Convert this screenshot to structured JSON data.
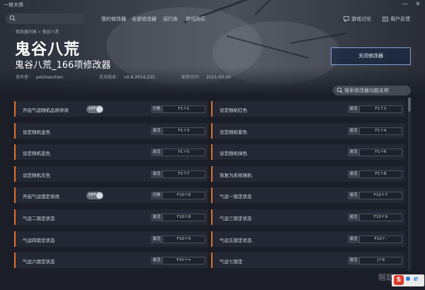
{
  "app": {
    "title": "一修大师"
  },
  "window": {
    "minimize": "—",
    "close": "✕"
  },
  "nav": {
    "items": [
      "我的修改器",
      "全部修改器",
      "运行库",
      "游戏购买"
    ]
  },
  "topright": {
    "discuss": "游戏讨论",
    "feedback": "用户反馈"
  },
  "breadcrumb": "修改器列表 » 鬼谷八荒",
  "game": {
    "title": "鬼谷八荒",
    "trainer_title": "鬼谷八荒_166项修改器"
  },
  "meta": {
    "publisher_label": "发布者：",
    "publisher": "peizhaochen",
    "version_label": "支持版本：",
    "version": "v0.8.2014.235",
    "updated_label": "更新时间：",
    "updated": "2021-03-30"
  },
  "close_trainer_button": "关闭修改器",
  "feature_search": {
    "placeholder": "搜索修改器功能名称"
  },
  "features": [
    {
      "label": "开启气运随机品质修改",
      "toggle": "OFF",
      "action": "切换",
      "hotkey": "F1＋1"
    },
    {
      "label": "设定随机红色",
      "action": "激活",
      "hotkey": "F1＋2"
    },
    {
      "label": "设定随机金色",
      "action": "激活",
      "hotkey": "F1＋3"
    },
    {
      "label": "设定随机紫色",
      "action": "激活",
      "hotkey": "F1＋4"
    },
    {
      "label": "设定随机蓝色",
      "action": "激活",
      "hotkey": "F1＋5"
    },
    {
      "label": "设定随机绿色",
      "action": "激活",
      "hotkey": "F1＋6"
    },
    {
      "label": "设定随机灰色",
      "action": "激活",
      "hotkey": "F1＋7"
    },
    {
      "label": "恢复为系统随机",
      "action": "激活",
      "hotkey": "F1＋8"
    },
    {
      "label": "开启气运锁定修改",
      "toggle": "OFF",
      "action": "切换",
      "hotkey": "F10＋6"
    },
    {
      "label": "气运一锁定状态",
      "action": "激活",
      "hotkey": "F10＋7"
    },
    {
      "label": "气运二锁定状态",
      "action": "激活",
      "hotkey": "F10＋8"
    },
    {
      "label": "气运三锁定状态",
      "action": "激活",
      "hotkey": "F10＋9"
    },
    {
      "label": "气运四锁定状态",
      "action": "激活",
      "hotkey": "F10＋0"
    },
    {
      "label": "气运五锁定状态",
      "action": "激活",
      "hotkey": "F10＋-"
    },
    {
      "label": "气运六锁定状态",
      "action": "激活",
      "hotkey": "F10＋="
    },
    {
      "label": "气运七锁定",
      "action": "激活",
      "hotkey": "]＋8"
    }
  ],
  "watermark": "帮助",
  "tray": {
    "s": "S"
  },
  "colors": {
    "accent": "#e0712e",
    "button_border": "#7ea4d8",
    "bg": "#1b1e27",
    "row": "#242834"
  }
}
